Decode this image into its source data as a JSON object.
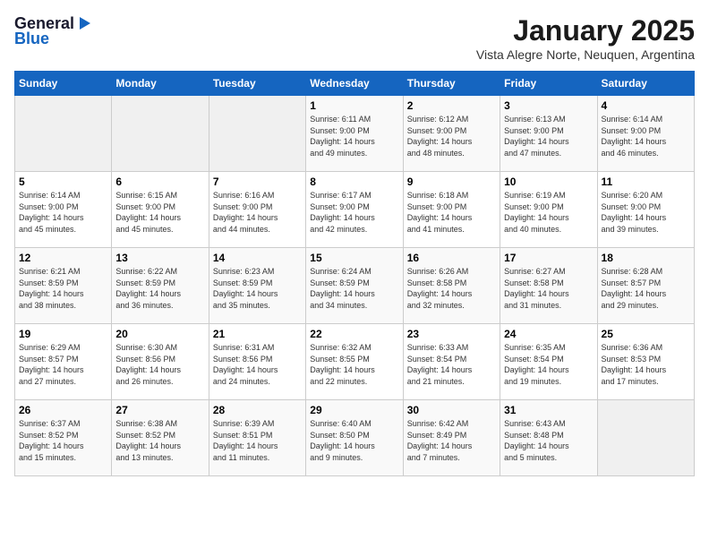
{
  "header": {
    "logo_general": "General",
    "logo_blue": "Blue",
    "month": "January 2025",
    "location": "Vista Alegre Norte, Neuquen, Argentina"
  },
  "days_of_week": [
    "Sunday",
    "Monday",
    "Tuesday",
    "Wednesday",
    "Thursday",
    "Friday",
    "Saturday"
  ],
  "weeks": [
    [
      {
        "day": "",
        "info": ""
      },
      {
        "day": "",
        "info": ""
      },
      {
        "day": "",
        "info": ""
      },
      {
        "day": "1",
        "info": "Sunrise: 6:11 AM\nSunset: 9:00 PM\nDaylight: 14 hours\nand 49 minutes."
      },
      {
        "day": "2",
        "info": "Sunrise: 6:12 AM\nSunset: 9:00 PM\nDaylight: 14 hours\nand 48 minutes."
      },
      {
        "day": "3",
        "info": "Sunrise: 6:13 AM\nSunset: 9:00 PM\nDaylight: 14 hours\nand 47 minutes."
      },
      {
        "day": "4",
        "info": "Sunrise: 6:14 AM\nSunset: 9:00 PM\nDaylight: 14 hours\nand 46 minutes."
      }
    ],
    [
      {
        "day": "5",
        "info": "Sunrise: 6:14 AM\nSunset: 9:00 PM\nDaylight: 14 hours\nand 45 minutes."
      },
      {
        "day": "6",
        "info": "Sunrise: 6:15 AM\nSunset: 9:00 PM\nDaylight: 14 hours\nand 45 minutes."
      },
      {
        "day": "7",
        "info": "Sunrise: 6:16 AM\nSunset: 9:00 PM\nDaylight: 14 hours\nand 44 minutes."
      },
      {
        "day": "8",
        "info": "Sunrise: 6:17 AM\nSunset: 9:00 PM\nDaylight: 14 hours\nand 42 minutes."
      },
      {
        "day": "9",
        "info": "Sunrise: 6:18 AM\nSunset: 9:00 PM\nDaylight: 14 hours\nand 41 minutes."
      },
      {
        "day": "10",
        "info": "Sunrise: 6:19 AM\nSunset: 9:00 PM\nDaylight: 14 hours\nand 40 minutes."
      },
      {
        "day": "11",
        "info": "Sunrise: 6:20 AM\nSunset: 9:00 PM\nDaylight: 14 hours\nand 39 minutes."
      }
    ],
    [
      {
        "day": "12",
        "info": "Sunrise: 6:21 AM\nSunset: 8:59 PM\nDaylight: 14 hours\nand 38 minutes."
      },
      {
        "day": "13",
        "info": "Sunrise: 6:22 AM\nSunset: 8:59 PM\nDaylight: 14 hours\nand 36 minutes."
      },
      {
        "day": "14",
        "info": "Sunrise: 6:23 AM\nSunset: 8:59 PM\nDaylight: 14 hours\nand 35 minutes."
      },
      {
        "day": "15",
        "info": "Sunrise: 6:24 AM\nSunset: 8:59 PM\nDaylight: 14 hours\nand 34 minutes."
      },
      {
        "day": "16",
        "info": "Sunrise: 6:26 AM\nSunset: 8:58 PM\nDaylight: 14 hours\nand 32 minutes."
      },
      {
        "day": "17",
        "info": "Sunrise: 6:27 AM\nSunset: 8:58 PM\nDaylight: 14 hours\nand 31 minutes."
      },
      {
        "day": "18",
        "info": "Sunrise: 6:28 AM\nSunset: 8:57 PM\nDaylight: 14 hours\nand 29 minutes."
      }
    ],
    [
      {
        "day": "19",
        "info": "Sunrise: 6:29 AM\nSunset: 8:57 PM\nDaylight: 14 hours\nand 27 minutes."
      },
      {
        "day": "20",
        "info": "Sunrise: 6:30 AM\nSunset: 8:56 PM\nDaylight: 14 hours\nand 26 minutes."
      },
      {
        "day": "21",
        "info": "Sunrise: 6:31 AM\nSunset: 8:56 PM\nDaylight: 14 hours\nand 24 minutes."
      },
      {
        "day": "22",
        "info": "Sunrise: 6:32 AM\nSunset: 8:55 PM\nDaylight: 14 hours\nand 22 minutes."
      },
      {
        "day": "23",
        "info": "Sunrise: 6:33 AM\nSunset: 8:54 PM\nDaylight: 14 hours\nand 21 minutes."
      },
      {
        "day": "24",
        "info": "Sunrise: 6:35 AM\nSunset: 8:54 PM\nDaylight: 14 hours\nand 19 minutes."
      },
      {
        "day": "25",
        "info": "Sunrise: 6:36 AM\nSunset: 8:53 PM\nDaylight: 14 hours\nand 17 minutes."
      }
    ],
    [
      {
        "day": "26",
        "info": "Sunrise: 6:37 AM\nSunset: 8:52 PM\nDaylight: 14 hours\nand 15 minutes."
      },
      {
        "day": "27",
        "info": "Sunrise: 6:38 AM\nSunset: 8:52 PM\nDaylight: 14 hours\nand 13 minutes."
      },
      {
        "day": "28",
        "info": "Sunrise: 6:39 AM\nSunset: 8:51 PM\nDaylight: 14 hours\nand 11 minutes."
      },
      {
        "day": "29",
        "info": "Sunrise: 6:40 AM\nSunset: 8:50 PM\nDaylight: 14 hours\nand 9 minutes."
      },
      {
        "day": "30",
        "info": "Sunrise: 6:42 AM\nSunset: 8:49 PM\nDaylight: 14 hours\nand 7 minutes."
      },
      {
        "day": "31",
        "info": "Sunrise: 6:43 AM\nSunset: 8:48 PM\nDaylight: 14 hours\nand 5 minutes."
      },
      {
        "day": "",
        "info": ""
      }
    ]
  ]
}
